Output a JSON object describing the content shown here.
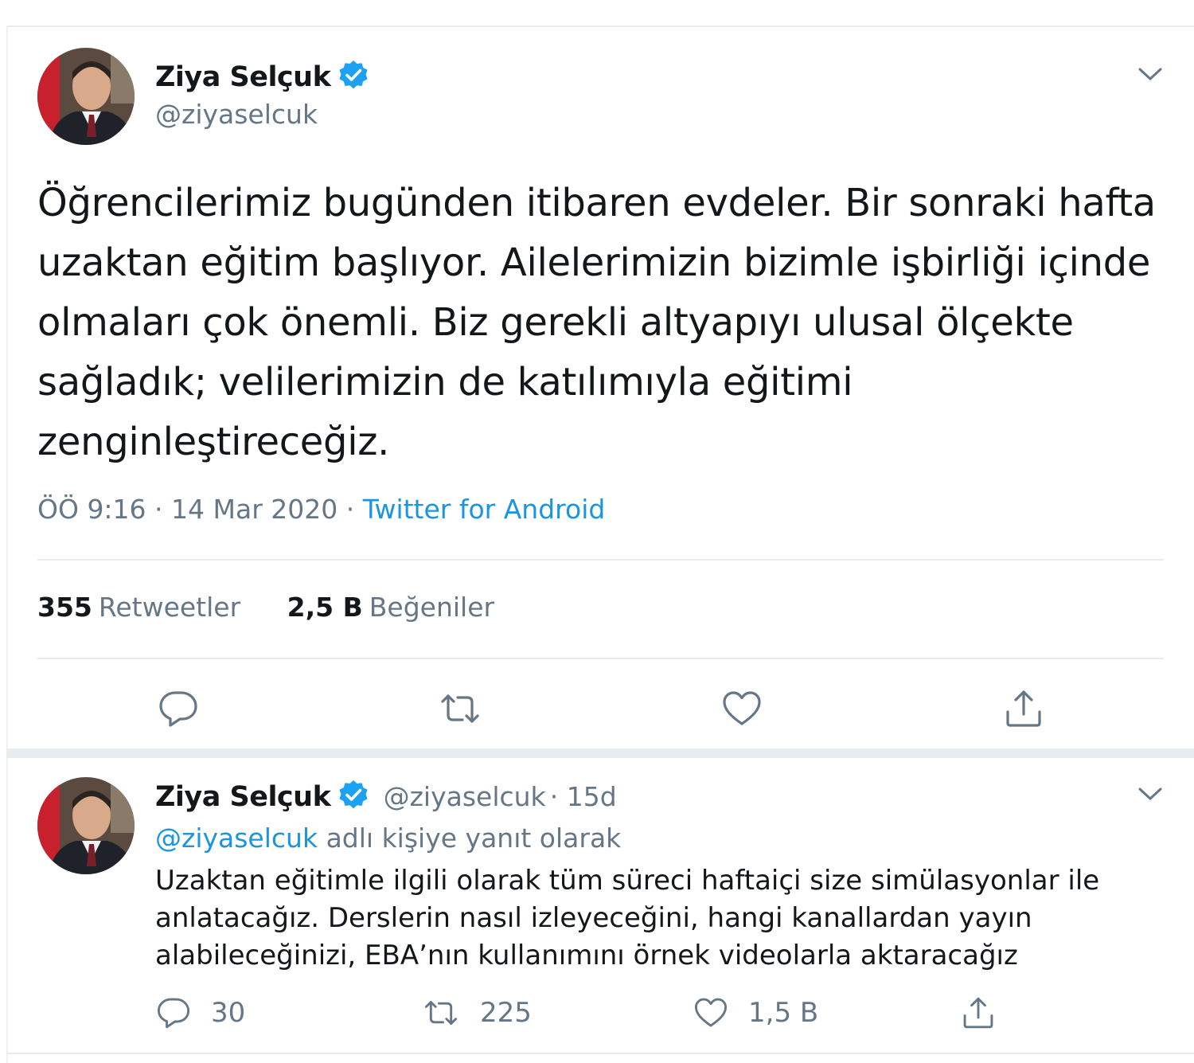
{
  "main_tweet": {
    "author_name": "Ziya Selçuk",
    "author_handle": "@ziyaselcuk",
    "text": "Öğrencilerimiz bugünden itibaren evdeler. Bir sonraki hafta uzaktan eğitim başlıyor. Ailelerimizin bizimle işbirliği içinde olmaları çok önemli. Biz gerekli altyapıyı ulusal ölçekte sağladık; velilerimizin de katılımıyla eğitimi zenginleştireceğiz.",
    "time": "ÖÖ 9:16",
    "date": "14 Mar 2020",
    "separator": "·",
    "source": "Twitter for Android",
    "retweet_count": "355",
    "retweet_label": "Retweetler",
    "like_count": "2,5 B",
    "like_label": "Beğeniler"
  },
  "reply_tweet": {
    "author_name": "Ziya Selçuk",
    "author_handle": "@ziyaselcuk",
    "age": "· 15d",
    "reply_to_handle": "@ziyaselcuk",
    "reply_to_suffix": "adlı kişiye yanıt olarak",
    "text": "Uzaktan eğitimle ilgili olarak tüm süreci haftaiçi size simülasyonlar ile anlatacağız. Derslerin nasıl izleyeceğini, hangi kanallardan yayın alabileceğinizi, EBA’nın kullanımını örnek videolarla aktaracağız",
    "reply_count": "30",
    "retweet_count": "225",
    "like_count": "1,5 B"
  },
  "icons": {
    "verified": "verified-badge-icon",
    "menu": "chevron-down-icon",
    "reply": "reply-icon",
    "retweet": "retweet-icon",
    "like": "heart-icon",
    "share": "share-icon"
  },
  "colors": {
    "link": "#1b95e0",
    "verified": "#1da1f2",
    "muted": "#657786",
    "text": "#14171a",
    "border": "#e6ecf0"
  }
}
